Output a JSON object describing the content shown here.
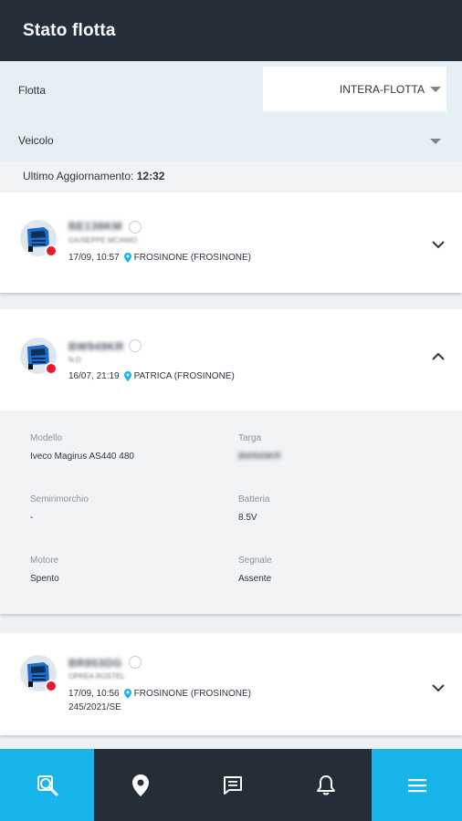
{
  "header": {
    "title": "Stato flotta"
  },
  "filters": {
    "flotta_label": "Flotta",
    "flotta_value": "INTERA-FLOTTA",
    "veicolo_label": "Veicolo",
    "veicolo_value": ""
  },
  "update": {
    "label": "Ultimo Aggiornamento:",
    "time": "12:32"
  },
  "vehicles": [
    {
      "plate": "BE138KM",
      "driver": "GIUSEPPE MCANIO",
      "datetime": "17/09, 10:57",
      "location": "FROSINONE (FROSINONE)",
      "expanded": false
    },
    {
      "plate": "BW949KR",
      "driver": "N.D",
      "datetime": "16/07, 21:19",
      "location": "PATRICA (FROSINONE)",
      "expanded": true,
      "details": {
        "modello_label": "Modello",
        "modello_value": "Iveco Magirus AS440 480",
        "targa_label": "Targa",
        "targa_value": "BW949KR",
        "semirimorchio_label": "Semirimorchio",
        "semirimorchio_value": "-",
        "batteria_label": "Batteria",
        "batteria_value": "8.5V",
        "motore_label": "Motore",
        "motore_value": "Spento",
        "segnale_label": "Segnale",
        "segnale_value": "Assente"
      }
    },
    {
      "plate": "BR853DG",
      "driver": "OPREA ROSTEL",
      "datetime": "17/09, 10:56",
      "location": "FROSINONE (FROSINONE)",
      "extra": "245/2021/SE",
      "expanded": false
    }
  ],
  "colors": {
    "header_bg": "#252d38",
    "accent": "#17b5e9",
    "status_red": "#e8192c",
    "pin": "#17b5e9"
  },
  "nav": [
    "search-truck-icon",
    "map-pin-icon",
    "message-icon",
    "bell-icon",
    "menu-icon"
  ]
}
